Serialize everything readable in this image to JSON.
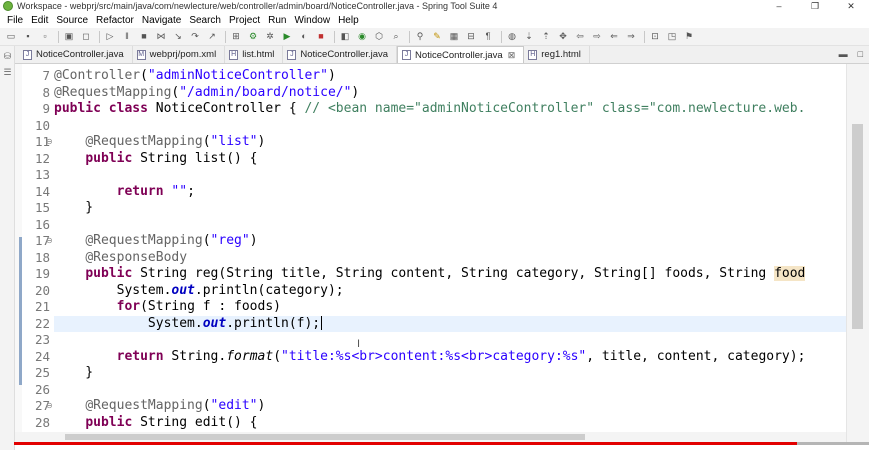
{
  "window": {
    "title": "Workspace - webprj/src/main/java/com/newlecture/web/controller/admin/board/NoticeController.java - Spring Tool Suite 4",
    "minimize": "–",
    "restore": "❐",
    "close": "✕"
  },
  "menu": [
    "File",
    "Edit",
    "Source",
    "Refactor",
    "Navigate",
    "Search",
    "Project",
    "Run",
    "Window",
    "Help"
  ],
  "tabs": [
    {
      "label": "NoticeController.java",
      "active": false
    },
    {
      "label": "webprj/pom.xml",
      "active": false
    },
    {
      "label": "list.html",
      "active": false
    },
    {
      "label": "NoticeController.java",
      "active": false
    },
    {
      "label": "NoticeController.java",
      "active": true
    },
    {
      "label": "reg1.html",
      "active": false
    }
  ],
  "tab_close": "⊠",
  "editor": {
    "lines": [
      {
        "num": "7",
        "fold": "",
        "html": "<span class=\"ann\">@Controller</span>(<span class=\"str\">\"adminNoticeController\"</span>)"
      },
      {
        "num": "8",
        "fold": "",
        "html": "<span class=\"ann\">@RequestMapping</span>(<span class=\"str\">\"/admin/board/notice/\"</span>)"
      },
      {
        "num": "9",
        "fold": "",
        "html": "<span class=\"kw\">public</span> <span class=\"kw\">class</span> NoticeController { <span class=\"cmt\">// &lt;bean name=\"adminNoticeController\" class=\"com.newlecture.web.</span>"
      },
      {
        "num": "10",
        "fold": "",
        "html": ""
      },
      {
        "num": "11",
        "fold": "⊖",
        "html": "    <span class=\"ann\">@RequestMapping</span>(<span class=\"str\">\"list\"</span>)"
      },
      {
        "num": "12",
        "fold": "",
        "html": "    <span class=\"kw\">public</span> String list() {"
      },
      {
        "num": "13",
        "fold": "",
        "html": ""
      },
      {
        "num": "14",
        "fold": "",
        "html": "        <span class=\"kw\">return</span> <span class=\"str\">\"\"</span>;"
      },
      {
        "num": "15",
        "fold": "",
        "html": "    }"
      },
      {
        "num": "16",
        "fold": "",
        "html": ""
      },
      {
        "num": "17",
        "fold": "⊖",
        "html": "    <span class=\"ann\">@RequestMapping</span>(<span class=\"str\">\"reg\"</span>)"
      },
      {
        "num": "18",
        "fold": "",
        "html": "    <span class=\"ann\">@ResponseBody</span>"
      },
      {
        "num": "19",
        "fold": "",
        "html": "    <span class=\"kw\">public</span> String reg(String title, String content, String category, String[] foods, String <span class=\"hl\">food</span>"
      },
      {
        "num": "20",
        "fold": "",
        "html": "        System.<span class=\"fld\">out</span>.println(category);"
      },
      {
        "num": "21",
        "fold": "",
        "html": "        <span class=\"kw\">for</span>(String f : foods)"
      },
      {
        "num": "22",
        "fold": "",
        "html": "            System.<span class=\"fld\">out</span>.println(f);<span class=\"caret\"></span>",
        "current": true
      },
      {
        "num": "23",
        "fold": "",
        "html": ""
      },
      {
        "num": "24",
        "fold": "",
        "html": "        <span class=\"kw\">return</span> String.<span class=\"itl\">format</span>(<span class=\"str\">\"title:%s&lt;br&gt;content:%s&lt;br&gt;category:%s\"</span>, title, content, category);"
      },
      {
        "num": "25",
        "fold": "",
        "html": "    }"
      },
      {
        "num": "26",
        "fold": "",
        "html": ""
      },
      {
        "num": "27",
        "fold": "⊖",
        "html": "    <span class=\"ann\">@RequestMapping</span>(<span class=\"str\">\"edit\"</span>)"
      },
      {
        "num": "28",
        "fold": "",
        "html": "    <span class=\"kw\">public</span> String edit() {"
      }
    ]
  },
  "icons": {
    "app": "spring-leaf-icon",
    "package_explorer": "package-explorer-icon",
    "outline": "outline-icon"
  },
  "colors": {
    "keyword": "#7f0055",
    "annotation": "#646464",
    "string": "#2a00ff",
    "comment": "#3f7f5f",
    "field": "#0000c0",
    "current_line": "#e8f2fe",
    "progress": "#e20000"
  }
}
